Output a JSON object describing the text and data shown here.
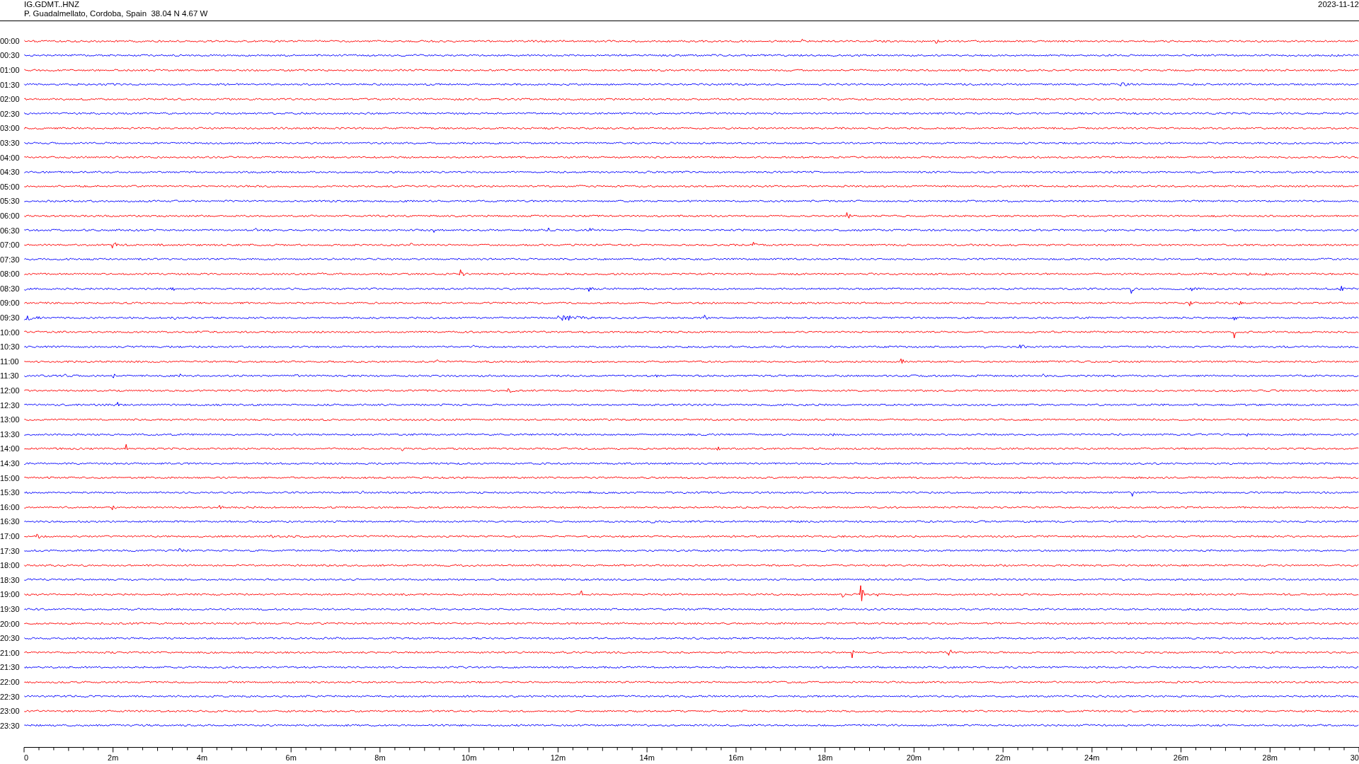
{
  "header": {
    "station": "IG.GDMT..HNZ",
    "location": "P. Guadalmellato, Cordoba, Spain  38.04 N 4.67 W",
    "date": "2023-11-12"
  },
  "rows": [
    {
      "time": "00:00",
      "color": "#ff0000"
    },
    {
      "time": "00:30",
      "color": "#0000ff"
    },
    {
      "time": "01:00",
      "color": "#ff0000"
    },
    {
      "time": "01:30",
      "color": "#0000ff"
    },
    {
      "time": "02:00",
      "color": "#ff0000"
    },
    {
      "time": "02:30",
      "color": "#0000ff"
    },
    {
      "time": "03:00",
      "color": "#ff0000"
    },
    {
      "time": "03:30",
      "color": "#0000ff"
    },
    {
      "time": "04:00",
      "color": "#ff0000"
    },
    {
      "time": "04:30",
      "color": "#0000ff"
    },
    {
      "time": "05:00",
      "color": "#ff0000"
    },
    {
      "time": "05:30",
      "color": "#0000ff"
    },
    {
      "time": "06:00",
      "color": "#ff0000"
    },
    {
      "time": "06:30",
      "color": "#0000ff"
    },
    {
      "time": "07:00",
      "color": "#ff0000"
    },
    {
      "time": "07:30",
      "color": "#0000ff"
    },
    {
      "time": "08:00",
      "color": "#ff0000"
    },
    {
      "time": "08:30",
      "color": "#0000ff"
    },
    {
      "time": "09:00",
      "color": "#ff0000"
    },
    {
      "time": "09:30",
      "color": "#0000ff"
    },
    {
      "time": "10:00",
      "color": "#ff0000"
    },
    {
      "time": "10:30",
      "color": "#0000ff"
    },
    {
      "time": "11:00",
      "color": "#ff0000"
    },
    {
      "time": "11:30",
      "color": "#0000ff"
    },
    {
      "time": "12:00",
      "color": "#ff0000"
    },
    {
      "time": "12:30",
      "color": "#0000ff"
    },
    {
      "time": "13:00",
      "color": "#ff0000"
    },
    {
      "time": "13:30",
      "color": "#0000ff"
    },
    {
      "time": "14:00",
      "color": "#ff0000"
    },
    {
      "time": "14:30",
      "color": "#0000ff"
    },
    {
      "time": "15:00",
      "color": "#ff0000"
    },
    {
      "time": "15:30",
      "color": "#0000ff"
    },
    {
      "time": "16:00",
      "color": "#ff0000"
    },
    {
      "time": "16:30",
      "color": "#0000ff"
    },
    {
      "time": "17:00",
      "color": "#ff0000"
    },
    {
      "time": "17:30",
      "color": "#0000ff"
    },
    {
      "time": "18:00",
      "color": "#ff0000"
    },
    {
      "time": "18:30",
      "color": "#0000ff"
    },
    {
      "time": "19:00",
      "color": "#ff0000"
    },
    {
      "time": "19:30",
      "color": "#0000ff"
    },
    {
      "time": "20:00",
      "color": "#ff0000"
    },
    {
      "time": "20:30",
      "color": "#0000ff"
    },
    {
      "time": "21:00",
      "color": "#ff0000"
    },
    {
      "time": "21:30",
      "color": "#0000ff"
    },
    {
      "time": "22:00",
      "color": "#ff0000"
    },
    {
      "time": "22:30",
      "color": "#0000ff"
    },
    {
      "time": "23:00",
      "color": "#ff0000"
    },
    {
      "time": "23:30",
      "color": "#0000ff"
    }
  ],
  "x_axis": {
    "labels": [
      "0",
      "2m",
      "4m",
      "6m",
      "8m",
      "10m",
      "12m",
      "14m",
      "16m",
      "18m",
      "20m",
      "22m",
      "24m",
      "26m",
      "28m",
      "30"
    ]
  }
}
